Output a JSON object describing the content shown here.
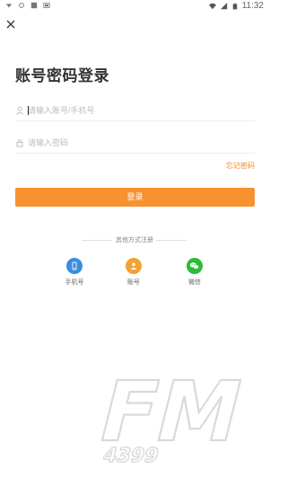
{
  "statusbar": {
    "time": "11:32"
  },
  "page": {
    "title": "账号密码登录"
  },
  "form": {
    "username_placeholder": "请输入账号/手机号",
    "password_placeholder": "请输入密码",
    "forgot_password": "忘记密码",
    "login_button": "登录"
  },
  "other_methods": {
    "divider_text": "其他方式注册",
    "items": [
      {
        "label": "手机号",
        "icon": "phone-icon",
        "color": "#3a8dde"
      },
      {
        "label": "账号",
        "icon": "user-icon",
        "color": "#f2a233"
      },
      {
        "label": "微信",
        "icon": "wechat-icon",
        "color": "#2dba38"
      }
    ]
  },
  "watermark": {
    "text": "FM",
    "subtext": "4399"
  },
  "colors": {
    "accent": "#f7922e",
    "link": "#f08a24"
  }
}
